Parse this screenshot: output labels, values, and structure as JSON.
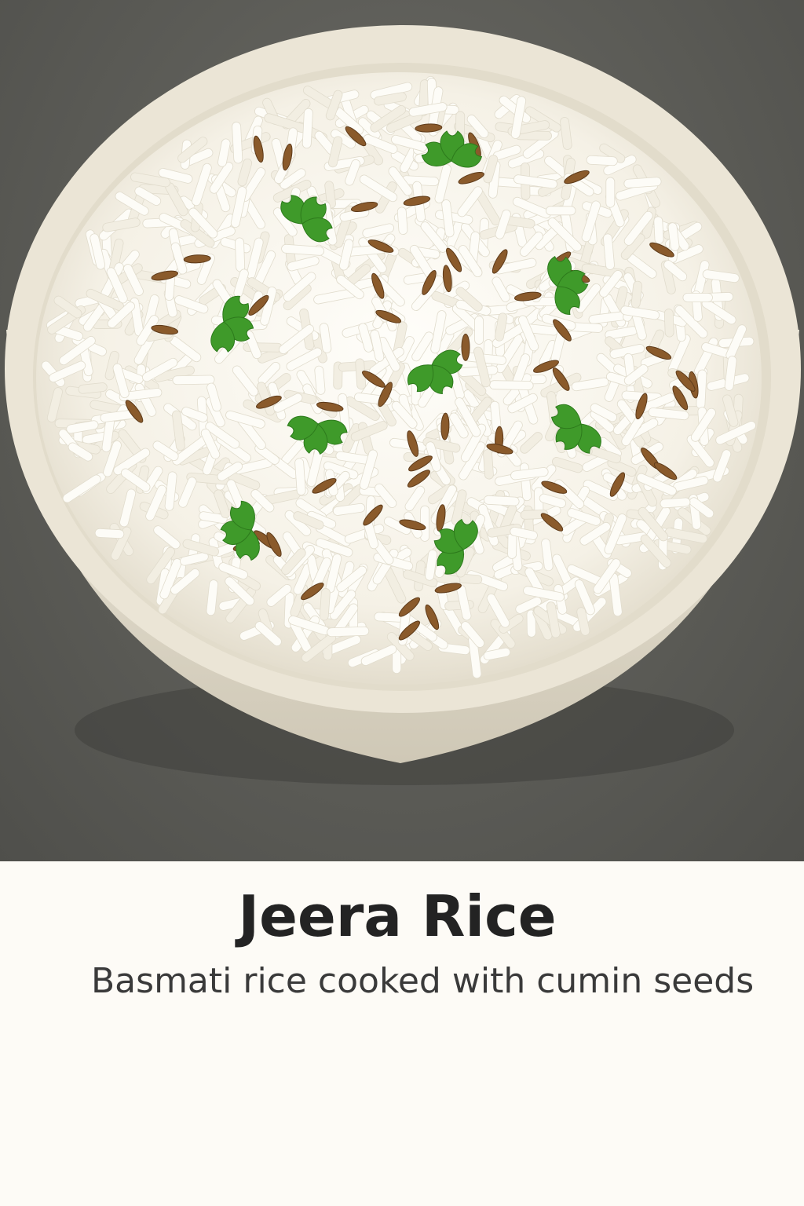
{
  "dish": {
    "title": "Jeera Rice",
    "subtitle": "Basmati rice cooked with cumin seeds"
  },
  "colors": {
    "table": "#5c5c57",
    "bowl": "#e9e3d4",
    "rice": "#fbfaf4",
    "cumin": "#8a5a2b",
    "cilantro": "#3f9a2a",
    "caption_bg": "#fdfbf6",
    "title_text": "#232323",
    "subtitle_text": "#3a3a3a"
  }
}
